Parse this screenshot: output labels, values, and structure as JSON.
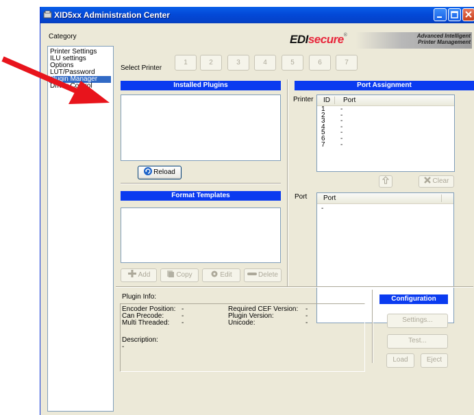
{
  "window": {
    "title": "XID5xx Administration Center"
  },
  "category": {
    "label": "Category",
    "items": [
      "Printer Settings",
      "ILU settings",
      "Options",
      "LUT/Password",
      "Plugin Manager",
      "Driver Control"
    ]
  },
  "brand": {
    "logo_edi": "EDI",
    "logo_secure": "secure",
    "logo_reg": "®",
    "tagline_1": "Advanced Intelligent",
    "tagline_2": "Printer Management"
  },
  "select_printer": {
    "label": "Select Printer",
    "buttons": [
      "1",
      "2",
      "3",
      "4",
      "5",
      "6",
      "7"
    ]
  },
  "installed_plugins": {
    "header": "Installed Plugins",
    "reload_label": "Reload"
  },
  "format_templates": {
    "header": "Format Templates",
    "add": "Add",
    "copy": "Copy",
    "edit": "Edit",
    "delete": "Delete"
  },
  "port_assignment": {
    "header": "Port Assignment",
    "printer_label": "Printer",
    "col_id": "ID",
    "col_port": "Port",
    "rows": [
      {
        "id": "1",
        "port": "-"
      },
      {
        "id": "2",
        "port": "-"
      },
      {
        "id": "3",
        "port": "-"
      },
      {
        "id": "4",
        "port": "-"
      },
      {
        "id": "5",
        "port": "-"
      },
      {
        "id": "6",
        "port": "-"
      },
      {
        "id": "7",
        "port": "-"
      }
    ],
    "clear_label": "Clear",
    "port_label": "Port",
    "port_col": "Port",
    "port_rows": [
      "-"
    ]
  },
  "plugin_info": {
    "label": "Plugin Info:",
    "encoder_position": "Encoder Position:",
    "encoder_position_val": "-",
    "can_precode": "Can Precode:",
    "can_precode_val": "-",
    "multi_threaded": "Multi Threaded:",
    "multi_threaded_val": "-",
    "required_cef": "Required CEF Version:",
    "required_cef_val": "-",
    "plugin_version": "Plugin Version:",
    "plugin_version_val": "-",
    "unicode": "Unicode:",
    "unicode_val": "-",
    "description": "Description:",
    "description_val": "-"
  },
  "configuration": {
    "header": "Configuration",
    "settings": "Settings...",
    "test": "Test...",
    "load": "Load",
    "eject": "Eject"
  },
  "colors": {
    "accent": "#0a3bf0",
    "titlebar": "#0349d8",
    "arrow": "#e8141c",
    "window_bg": "#ece9d8"
  }
}
